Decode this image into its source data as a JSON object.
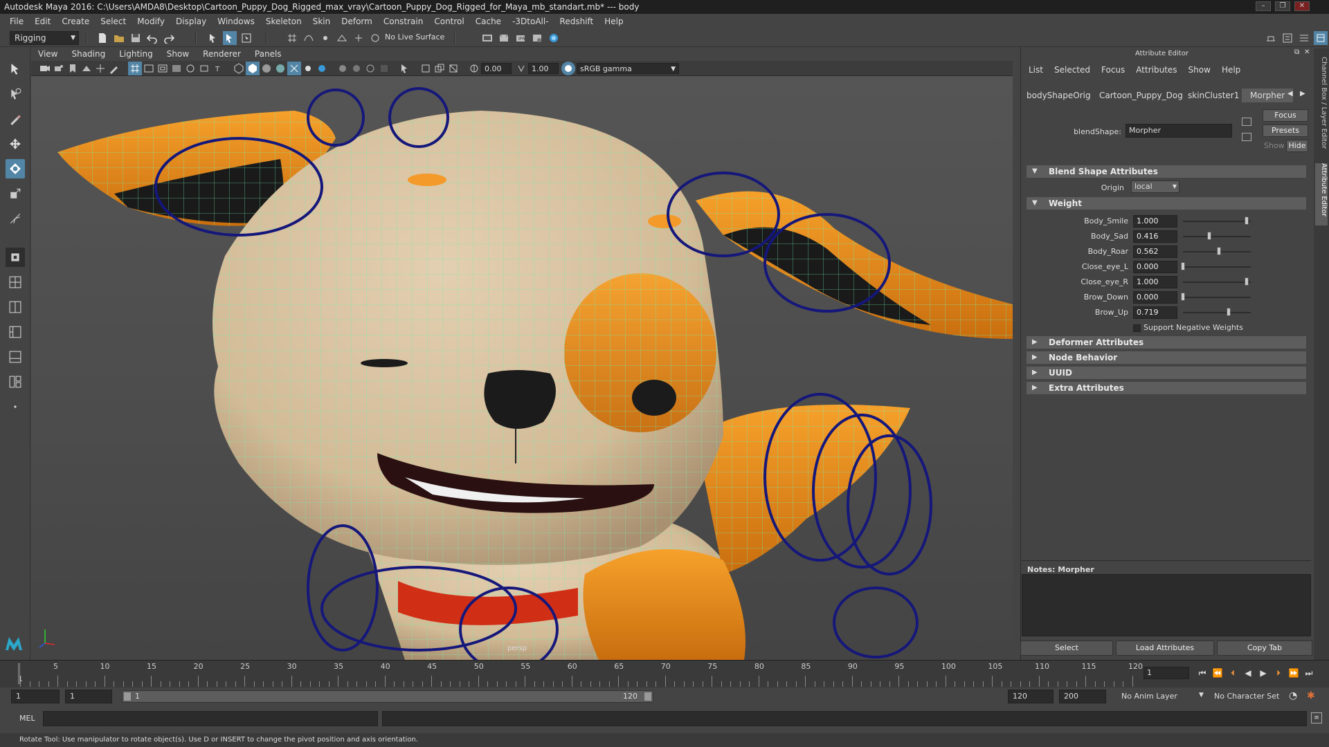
{
  "title": "Autodesk Maya 2016: C:\\Users\\AMDA8\\Desktop\\Cartoon_Puppy_Dog_Rigged_max_vray\\Cartoon_Puppy_Dog_Rigged_for_Maya_mb_standart.mb*   ---   body",
  "window_buttons": [
    "–",
    "❐",
    "✕"
  ],
  "menu": [
    "File",
    "Edit",
    "Create",
    "Select",
    "Modify",
    "Display",
    "Windows",
    "Skeleton",
    "Skin",
    "Deform",
    "Constrain",
    "Control",
    "Cache",
    "-3DtoAll-",
    "Redshift",
    "Help"
  ],
  "statusline": {
    "mode": "Rigging",
    "live_surface": "No Live Surface"
  },
  "viewport": {
    "menu": [
      "View",
      "Shading",
      "Lighting",
      "Show",
      "Renderer",
      "Panels"
    ],
    "exposure": "0.00",
    "gamma": "1.00",
    "colorspace": "sRGB gamma",
    "camera": "persp"
  },
  "attribute_editor": {
    "header": "Attribute Editor",
    "menu": [
      "List",
      "Selected",
      "Focus",
      "Attributes",
      "Show",
      "Help"
    ],
    "tabs": [
      "bodyShapeOrig",
      "Cartoon_Puppy_Dog",
      "skinCluster1",
      "Morpher"
    ],
    "active_tab": "Morpher",
    "buttons": {
      "focus": "Focus",
      "presets": "Presets",
      "show": "Show",
      "hide": "Hide"
    },
    "node_label": "blendShape:",
    "node_value": "Morpher",
    "sections": {
      "blend": "Blend Shape Attributes",
      "origin_label": "Origin",
      "origin_value": "local",
      "weight": "Weight",
      "support_neg": "Support Negative Weights",
      "deformer": "Deformer Attributes",
      "node_behavior": "Node Behavior",
      "uuid": "UUID",
      "extra": "Extra Attributes"
    },
    "weights": [
      {
        "name": "Body_Smile",
        "value": "1.000",
        "level": 1.0
      },
      {
        "name": "Body_Sad",
        "value": "0.416",
        "level": 0.416
      },
      {
        "name": "Body_Roar",
        "value": "0.562",
        "level": 0.562
      },
      {
        "name": "Close_eye_L",
        "value": "0.000",
        "level": 0.0
      },
      {
        "name": "Close_eye_R",
        "value": "1.000",
        "level": 1.0
      },
      {
        "name": "Brow_Down",
        "value": "0.000",
        "level": 0.0
      },
      {
        "name": "Brow_Up",
        "value": "0.719",
        "level": 0.719
      }
    ],
    "notes": "Notes:  Morpher",
    "bottom_buttons": {
      "select": "Select",
      "load": "Load Attributes",
      "copy": "Copy Tab"
    },
    "side_tabs": [
      "Channel Box / Layer Editor",
      "Attribute Editor"
    ]
  },
  "timeline": {
    "ticks": [
      "5",
      "10",
      "15",
      "20",
      "25",
      "30",
      "35",
      "40",
      "45",
      "50",
      "55",
      "60",
      "65",
      "70",
      "75",
      "80",
      "85",
      "90",
      "95",
      "100",
      "105",
      "110",
      "115",
      "120"
    ],
    "start_label": "1",
    "current_frame": "1"
  },
  "range": {
    "start": "1",
    "start2": "1",
    "range_start": "1",
    "range_end": "120",
    "end": "120",
    "end2": "200",
    "anim_layer": "No Anim Layer",
    "char_set": "No Character Set"
  },
  "cmd": {
    "label": "MEL"
  },
  "help": "Rotate Tool: Use manipulator to rotate object(s). Use D or INSERT to change the pivot position and axis orientation."
}
